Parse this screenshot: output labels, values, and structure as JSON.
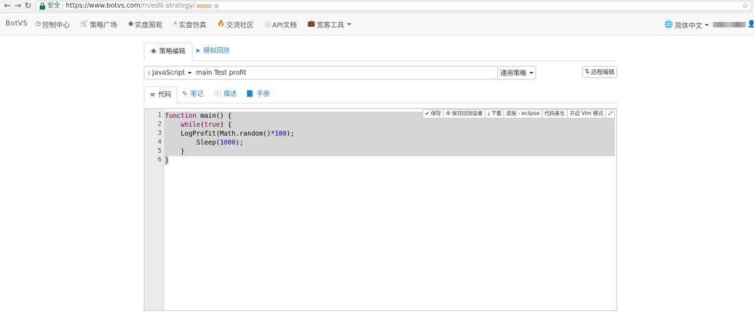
{
  "browser": {
    "secure_label": "安全",
    "url_host": "https://www.botvs.com",
    "url_path": "/m/edit-strategy/"
  },
  "navbar": {
    "brand": "BotVS",
    "items": [
      {
        "label": "控制中心",
        "icon": "dashboard-icon"
      },
      {
        "label": "策略广场",
        "icon": "cart-icon"
      },
      {
        "label": "实盘围观",
        "icon": "eye-icon"
      },
      {
        "label": "实盘仿真",
        "icon": "bolt-icon"
      },
      {
        "label": "交流社区",
        "icon": "fire-icon"
      },
      {
        "label": "API文档",
        "icon": "info-icon"
      },
      {
        "label": "宽客工具",
        "icon": "briefcase-icon"
      }
    ],
    "language": "简体中文"
  },
  "top_tabs": [
    {
      "label": "策略编辑",
      "icon": "cubes-icon",
      "active": true
    },
    {
      "label": "模拟回测",
      "icon": "paper-plane-icon",
      "active": false
    }
  ],
  "toolbar": {
    "language_select": "JavaScript",
    "strategy_name": "main Test profit",
    "category_select": "通用策略",
    "remote_edit_label": "远程编辑"
  },
  "sub_tabs": [
    {
      "label": "代码",
      "icon": "list-icon",
      "active": true
    },
    {
      "label": "笔记",
      "icon": "edit-icon",
      "active": false
    },
    {
      "label": "描述",
      "icon": "info-icon",
      "active": false
    },
    {
      "label": "手册",
      "icon": "book-icon",
      "active": false
    }
  ],
  "editor": {
    "toolbar": [
      {
        "label": "保存",
        "icon": "check-icon"
      },
      {
        "label": "保存回测设置",
        "icon": "gear-icon"
      },
      {
        "label": "下载",
        "icon": "download-icon"
      },
      {
        "label": "皮肤 - eclipse",
        "icon": ""
      },
      {
        "label": "代码美化",
        "icon": ""
      },
      {
        "label": "开启 Vim 模式",
        "icon": ""
      },
      {
        "label": "",
        "icon": "expand-icon"
      }
    ],
    "line_numbers": [
      "1",
      "2",
      "3",
      "4",
      "5",
      "6"
    ]
  },
  "colors": {
    "link": "#337ab7",
    "secure_green": "#0b8043",
    "keyword": "#7f0055",
    "number": "#0000c0",
    "selection": "#d6d6d6"
  }
}
